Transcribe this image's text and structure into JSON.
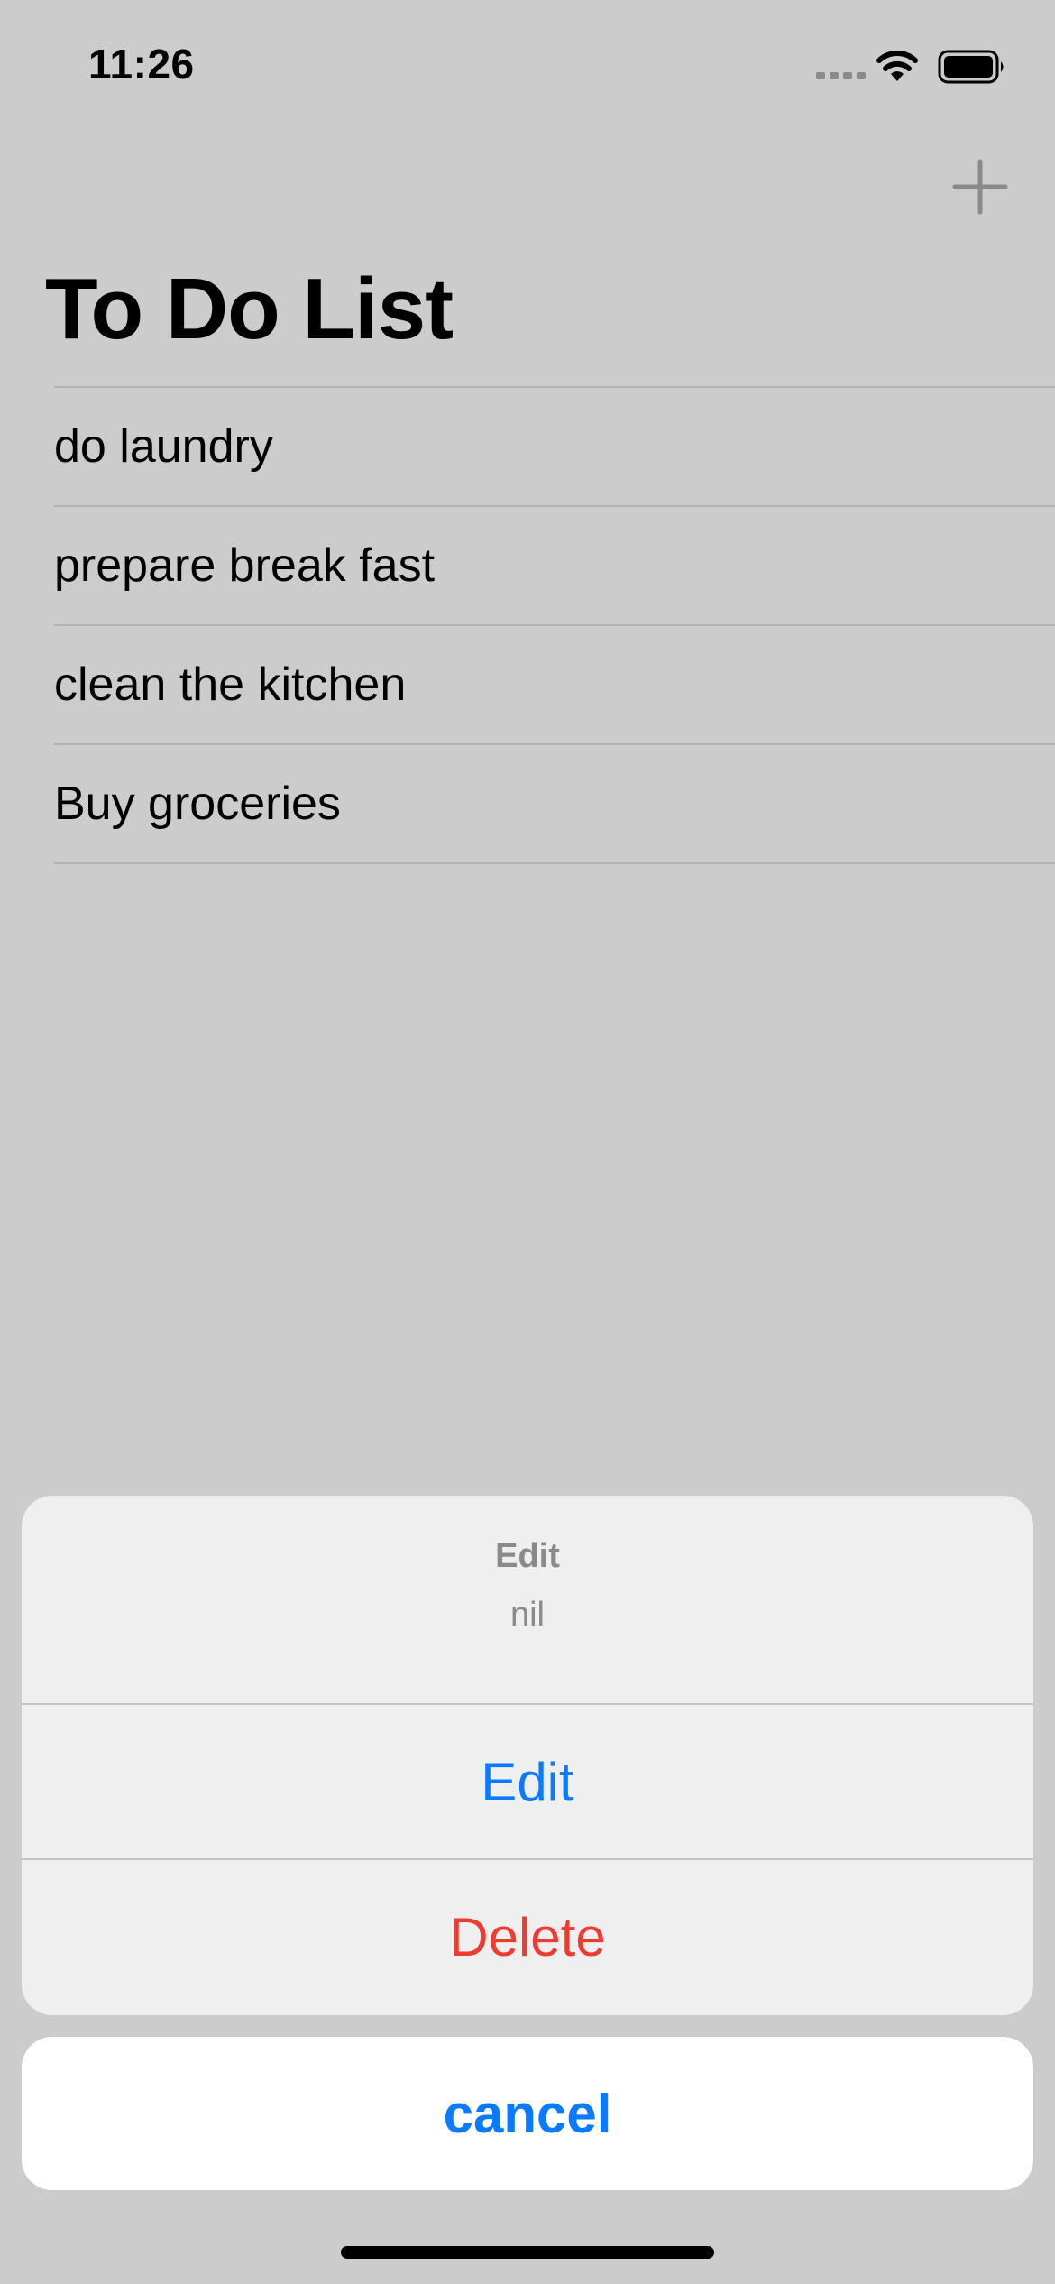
{
  "status_bar": {
    "time": "11:26",
    "icons": [
      "cellular-signal-icon",
      "wifi-icon",
      "battery-icon"
    ]
  },
  "nav": {
    "title": "To Do List",
    "add_icon": "plus-icon"
  },
  "todo_items": [
    "do laundry",
    "prepare break fast",
    "clean the kitchen",
    "Buy groceries"
  ],
  "action_sheet": {
    "title": "Edit",
    "message": "nil",
    "actions": {
      "edit_label": "Edit",
      "delete_label": "Delete"
    },
    "cancel_label": "cancel"
  },
  "colors": {
    "background": "#cccccc",
    "sheet_background": "#efefef",
    "accent": "#0a7aff",
    "destructive": "#ef3b32",
    "secondary_text": "#8a8a8a"
  }
}
